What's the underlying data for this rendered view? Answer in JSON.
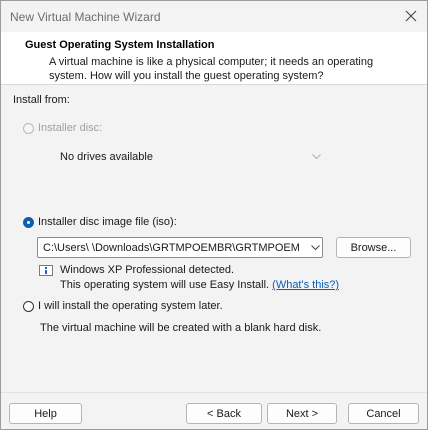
{
  "window": {
    "title": "New Virtual Machine Wizard"
  },
  "header": {
    "title": "Guest Operating System Installation",
    "description_line1": "A virtual machine is like a physical computer; it needs an operating",
    "description_line2": "system. How will you install the guest operating system?"
  },
  "install_from": {
    "label": "Install from:",
    "disc": {
      "label": "Installer disc:",
      "selected": false,
      "enabled": false,
      "drive": "No drives available"
    },
    "iso": {
      "label": "Installer disc image file (iso):",
      "selected": true,
      "path": "C:\\Users\\        \\Downloads\\GRTMPOEMBR\\GRTMPOEM",
      "browse_label": "Browse...",
      "detected_text": "Windows XP Professional detected.",
      "easy_install_text": "This operating system will use Easy Install.",
      "whats_this_link": "(What's this?)"
    },
    "later": {
      "label": "I will install the operating system later.",
      "selected": false,
      "description": "The virtual machine will be created with a blank hard disk."
    }
  },
  "footer": {
    "help_label": "Help",
    "back_label": "< Back",
    "next_label": "Next >",
    "cancel_label": "Cancel"
  },
  "icons": {
    "close": "close-icon",
    "dropdown": "chevron-down-icon",
    "info": "info-icon"
  },
  "colors": {
    "accent": "#0a5fb4",
    "link": "#0a5fb4"
  }
}
